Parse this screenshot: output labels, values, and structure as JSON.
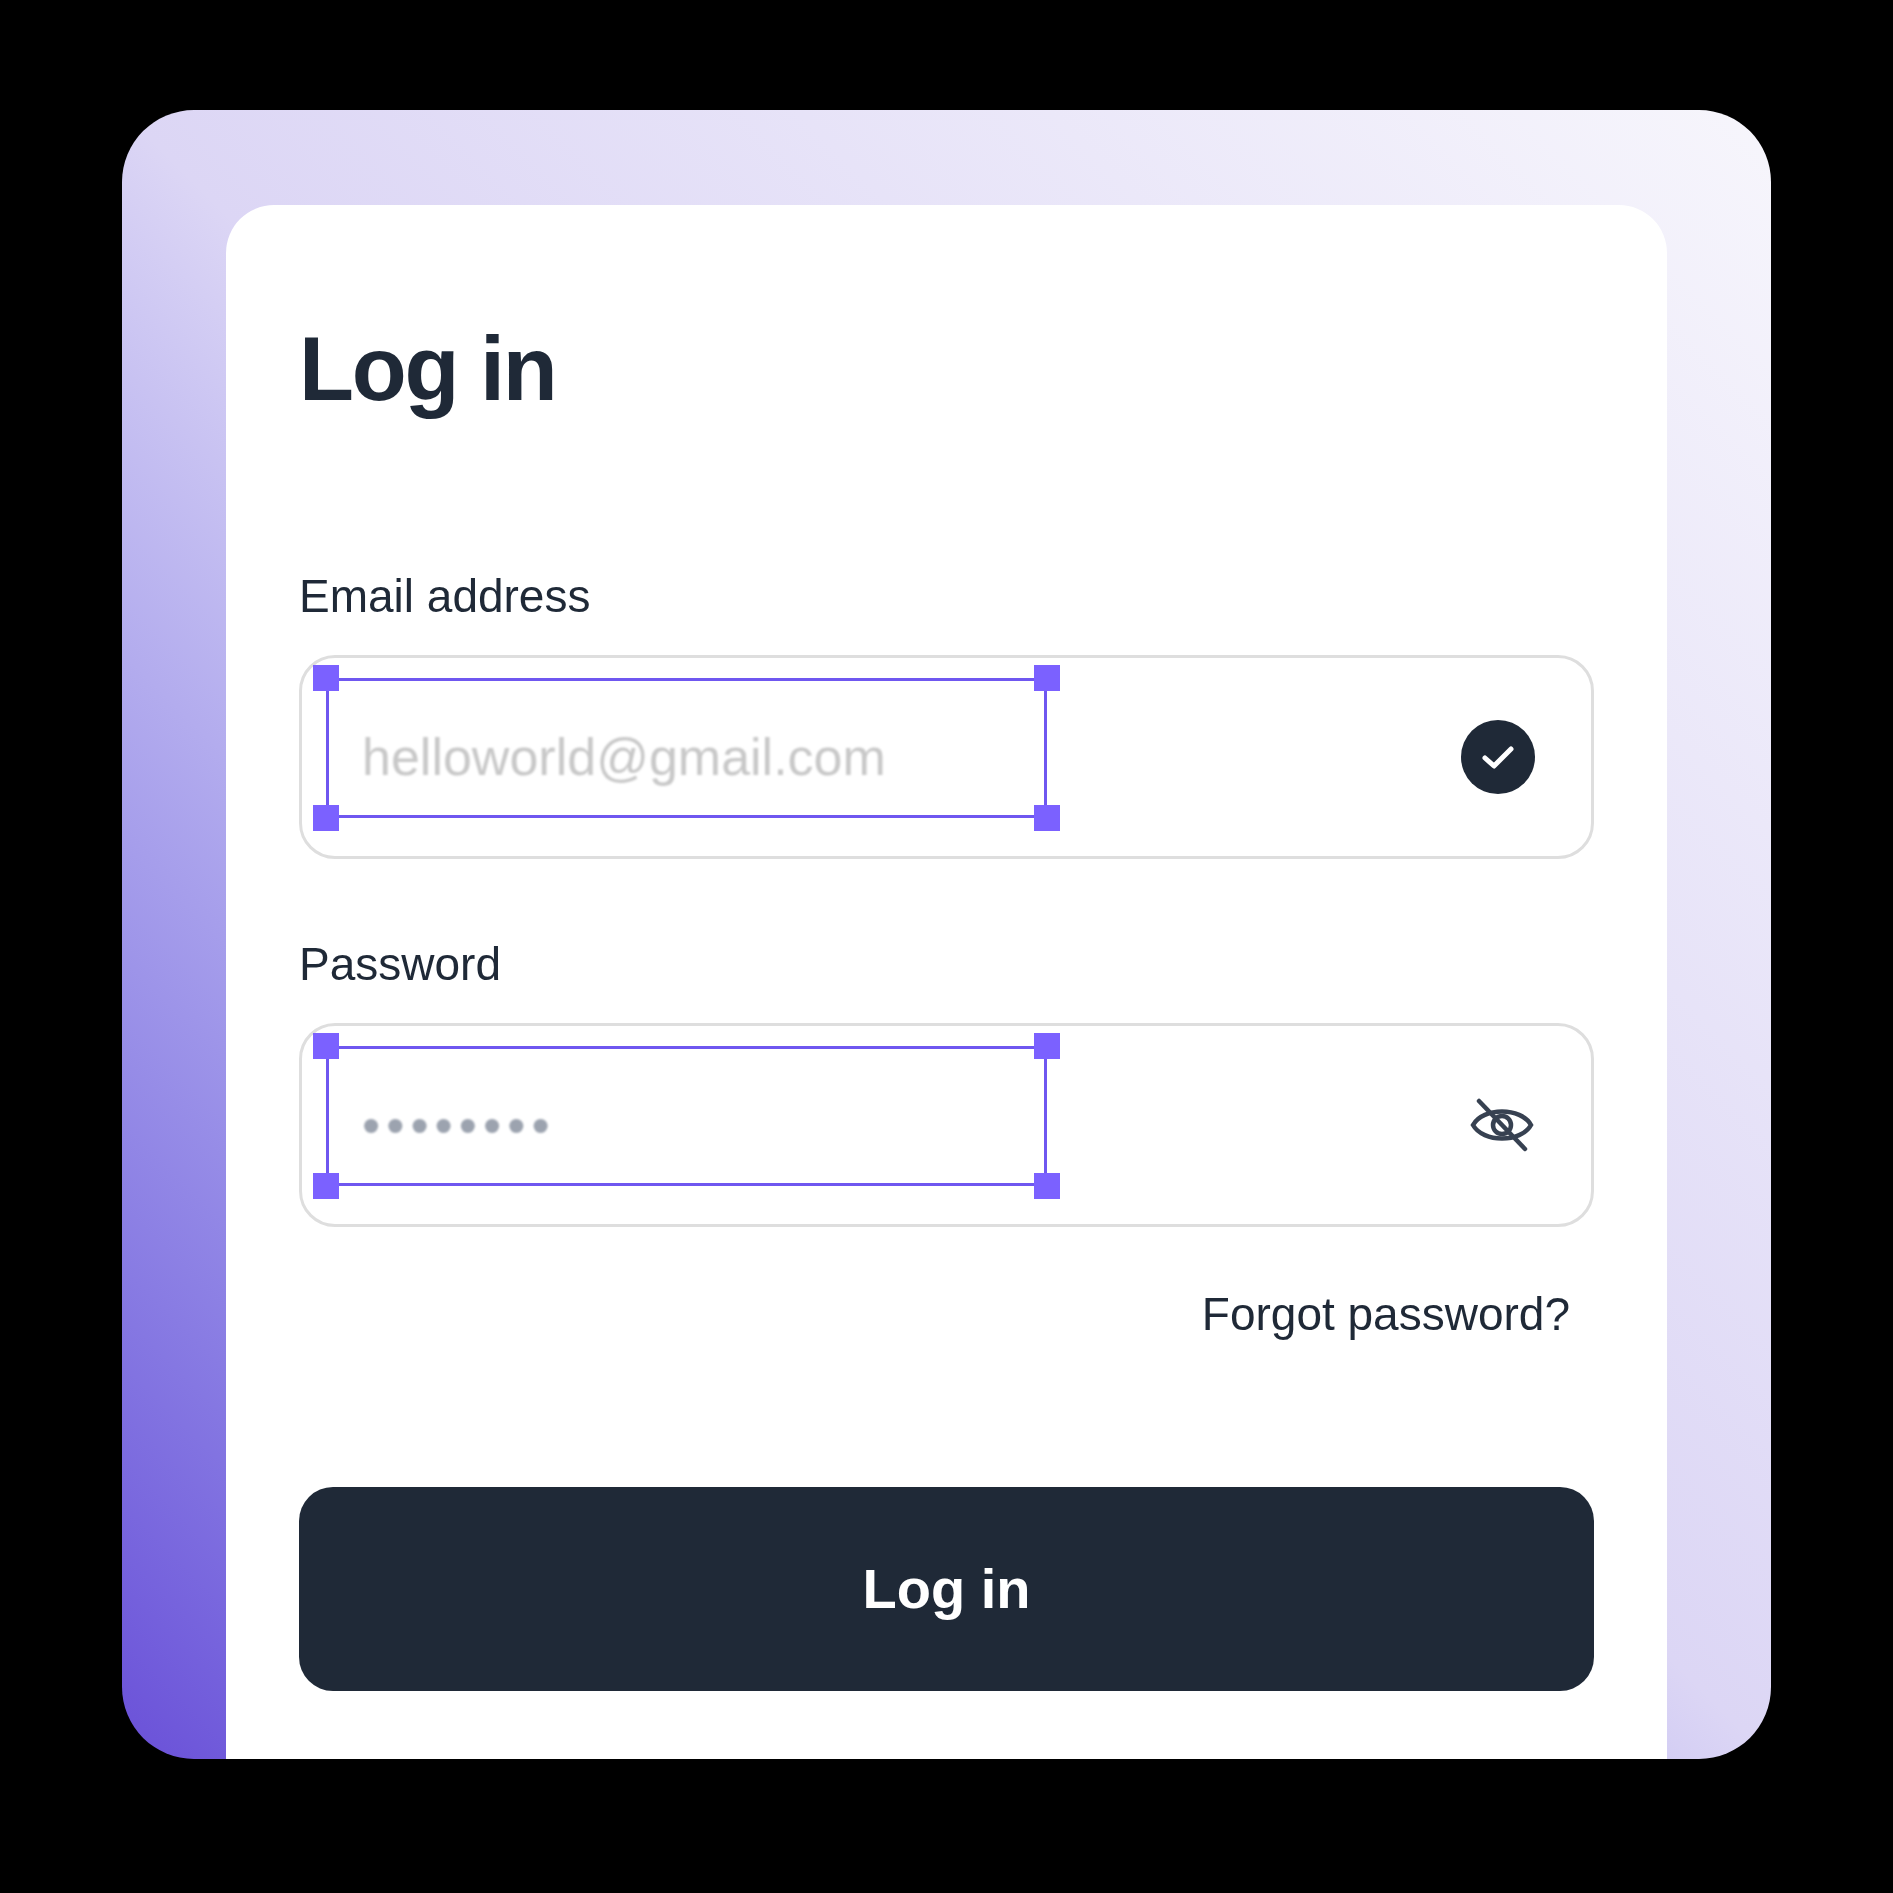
{
  "title": "Log in",
  "fields": [
    {
      "kind": "email",
      "label": "Email address",
      "value": "helloworld@gmail.com",
      "selected": true,
      "valid": true
    },
    {
      "kind": "password",
      "label": "Password",
      "value": "••••••••",
      "selected": true,
      "masked": true
    }
  ],
  "forgot_link": "Forgot password?",
  "submit_button": "Log in"
}
